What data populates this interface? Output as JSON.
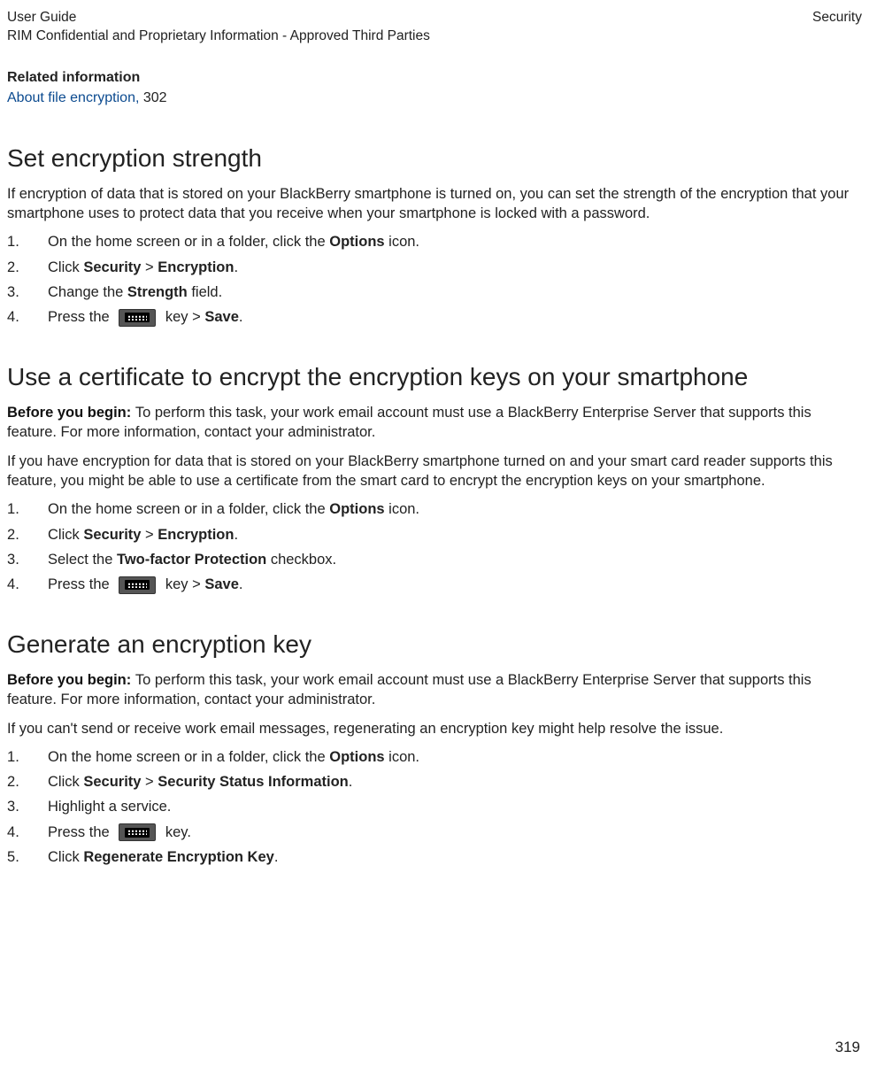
{
  "header": {
    "guide": "User Guide",
    "confidential": "RIM Confidential and Proprietary Information - Approved Third Parties",
    "section": "Security"
  },
  "related": {
    "heading": "Related information",
    "link_text": "About file encryption, ",
    "page_ref": "302"
  },
  "s1": {
    "title": "Set encryption strength",
    "intro": "If encryption of data that is stored on your BlackBerry smartphone is turned on, you can set the strength of the encryption that your smartphone uses to protect data that you receive when your smartphone is locked with a password.",
    "step1_a": "On the home screen or in a folder, click the ",
    "step1_b": "Options",
    "step1_c": " icon.",
    "step2_a": "Click ",
    "step2_b": "Security",
    "step2_c": " > ",
    "step2_d": "Encryption",
    "step2_e": ".",
    "step3_a": "Change the ",
    "step3_b": "Strength",
    "step3_c": " field.",
    "step4_a": "Press the ",
    "step4_b": " key > ",
    "step4_c": "Save",
    "step4_d": "."
  },
  "s2": {
    "title": "Use a certificate to encrypt the encryption keys on your smartphone",
    "byb_label": "Before you begin: ",
    "byb_text": "To perform this task, your work email account must use a BlackBerry Enterprise Server that supports this feature. For more information, contact your administrator.",
    "intro": "If you have encryption for data that is stored on your BlackBerry smartphone turned on and your smart card reader supports this feature, you might be able to use a certificate from the smart card to encrypt the encryption keys on your smartphone.",
    "step1_a": "On the home screen or in a folder, click the ",
    "step1_b": "Options",
    "step1_c": " icon.",
    "step2_a": "Click ",
    "step2_b": "Security",
    "step2_c": " > ",
    "step2_d": "Encryption",
    "step2_e": ".",
    "step3_a": "Select the ",
    "step3_b": "Two-factor Protection",
    "step3_c": " checkbox.",
    "step4_a": "Press the ",
    "step4_b": " key > ",
    "step4_c": "Save",
    "step4_d": "."
  },
  "s3": {
    "title": "Generate an encryption key",
    "byb_label": "Before you begin: ",
    "byb_text": "To perform this task, your work email account must use a BlackBerry Enterprise Server that supports this feature. For more information, contact your administrator.",
    "intro": "If you can't send or receive work email messages, regenerating an encryption key might help resolve the issue.",
    "step1_a": "On the home screen or in a folder, click the ",
    "step1_b": "Options",
    "step1_c": " icon.",
    "step2_a": "Click ",
    "step2_b": "Security",
    "step2_c": " > ",
    "step2_d": "Security Status Information",
    "step2_e": ".",
    "step3_a": "Highlight a service.",
    "step4_a": "Press the ",
    "step4_b": " key.",
    "step5_a": "Click ",
    "step5_b": "Regenerate Encryption Key",
    "step5_c": "."
  },
  "page_number": "319"
}
